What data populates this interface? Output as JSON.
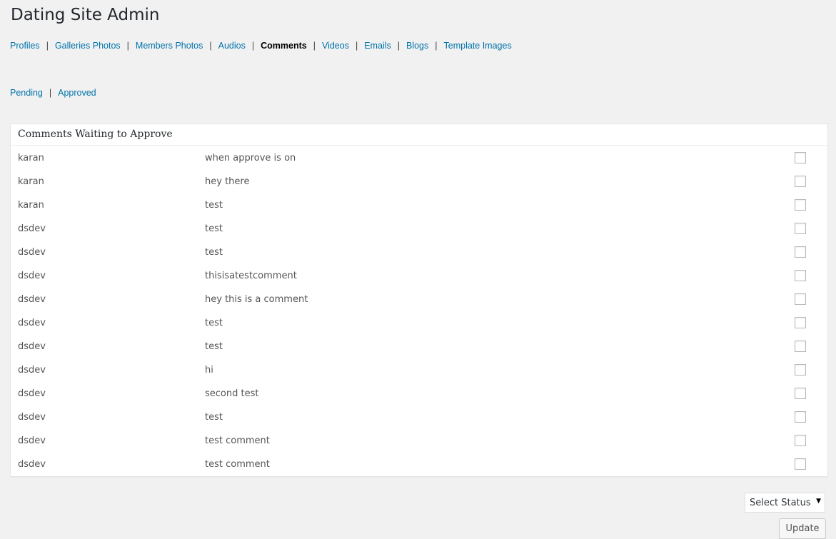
{
  "header": {
    "title": "Dating Site Admin"
  },
  "main_nav": {
    "items": [
      {
        "label": "Profiles"
      },
      {
        "label": "Galleries Photos"
      },
      {
        "label": "Members Photos"
      },
      {
        "label": "Audios"
      },
      {
        "label": "Comments",
        "current": true
      },
      {
        "label": "Videos"
      },
      {
        "label": "Emails"
      },
      {
        "label": "Blogs"
      },
      {
        "label": "Template Images"
      }
    ],
    "separator": "|"
  },
  "sub_nav": {
    "items": [
      {
        "label": "Pending"
      },
      {
        "label": "Approved"
      }
    ]
  },
  "panel": {
    "title": "Comments Waiting to Approve",
    "rows": [
      {
        "author": "karan",
        "comment": "when approve is on"
      },
      {
        "author": "karan",
        "comment": "hey there"
      },
      {
        "author": "karan",
        "comment": "test"
      },
      {
        "author": "dsdev",
        "comment": "test"
      },
      {
        "author": "dsdev",
        "comment": "test"
      },
      {
        "author": "dsdev",
        "comment": "thisisatestcomment"
      },
      {
        "author": "dsdev",
        "comment": "hey this is a comment"
      },
      {
        "author": "dsdev",
        "comment": "test"
      },
      {
        "author": "dsdev",
        "comment": "test"
      },
      {
        "author": "dsdev",
        "comment": "hi"
      },
      {
        "author": "dsdev",
        "comment": "second test"
      },
      {
        "author": "dsdev",
        "comment": "test"
      },
      {
        "author": "dsdev",
        "comment": "test comment"
      },
      {
        "author": "dsdev",
        "comment": "test comment"
      }
    ]
  },
  "controls": {
    "status_select": "Select Status",
    "update_label": "Update"
  },
  "colors": {
    "link": "#0073aa",
    "background": "#f1f1f1",
    "panel": "#ffffff"
  }
}
